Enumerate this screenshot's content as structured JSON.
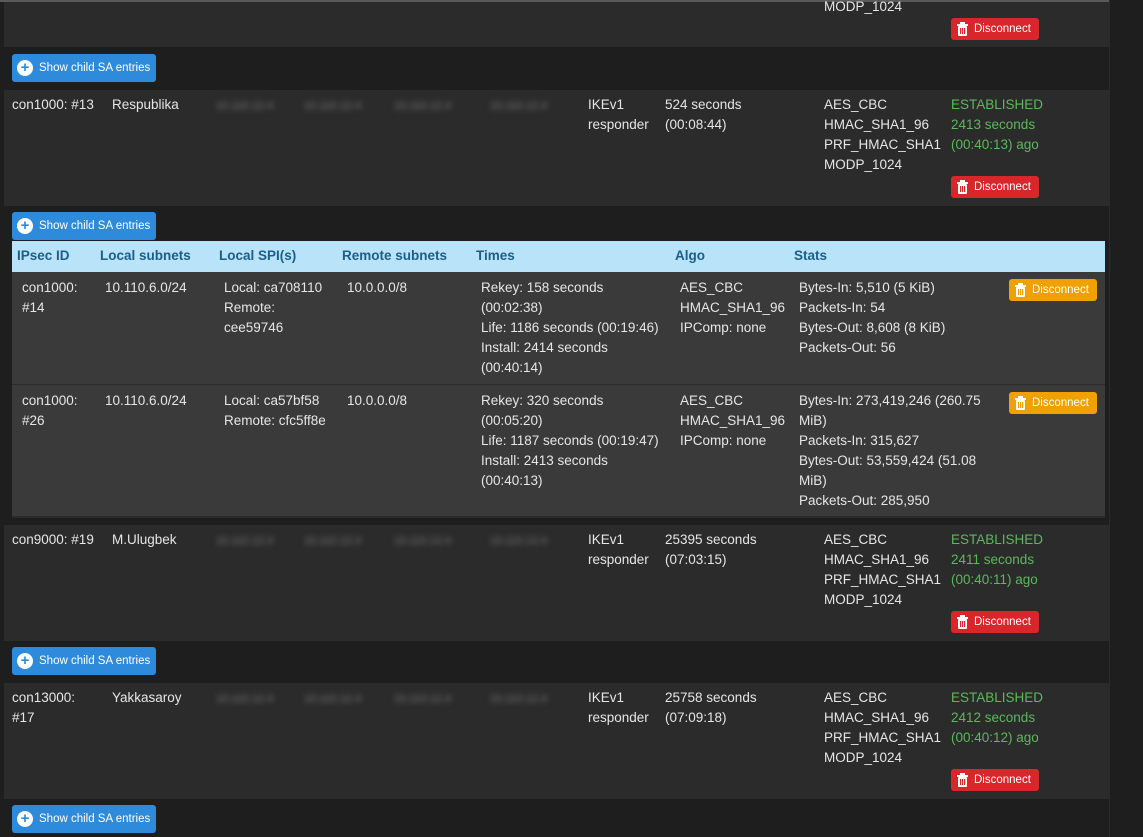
{
  "top_partial": {
    "algo_last": "MODP_1024",
    "disconnect_label": "Disconnect"
  },
  "show_child_label": "Show child SA entries",
  "blurred_address_placeholder": "10.110.12.4",
  "sa_entries": [
    {
      "id": "con1000: #13",
      "description": "Respublika",
      "ike_version": "IKEv1",
      "role": "responder",
      "life_seconds": "524 seconds",
      "life_hms": "(00:08:44)",
      "algo": [
        "AES_CBC",
        "HMAC_SHA1_96",
        "PRF_HMAC_SHA1",
        "MODP_1024"
      ],
      "status": "ESTABLISHED",
      "established_seconds": "2413 seconds",
      "established_ago": "(00:40:13) ago",
      "disconnect_label": "Disconnect"
    },
    {
      "id": "con9000: #19",
      "description": "M.Ulugbek",
      "ike_version": "IKEv1",
      "role": "responder",
      "life_seconds": "25395 seconds",
      "life_hms": "(07:03:15)",
      "algo": [
        "AES_CBC",
        "HMAC_SHA1_96",
        "PRF_HMAC_SHA1",
        "MODP_1024"
      ],
      "status": "ESTABLISHED",
      "established_seconds": "2411 seconds",
      "established_ago": "(00:40:11) ago",
      "disconnect_label": "Disconnect"
    },
    {
      "id_line1": "con13000:",
      "id_line2": "#17",
      "description": "Yakkasaroy",
      "ike_version": "IKEv1",
      "role": "responder",
      "life_seconds": "25758 seconds",
      "life_hms": "(07:09:18)",
      "algo": [
        "AES_CBC",
        "HMAC_SHA1_96",
        "PRF_HMAC_SHA1",
        "MODP_1024"
      ],
      "status": "ESTABLISHED",
      "established_seconds": "2412 seconds",
      "established_ago": "(00:40:12) ago",
      "disconnect_label": "Disconnect"
    }
  ],
  "child_table": {
    "headers": [
      "IPsec ID",
      "Local subnets",
      "Local SPI(s)",
      "Remote subnets",
      "Times",
      "Algo",
      "Stats"
    ],
    "rows": [
      {
        "ipsec_id": [
          "con1000:",
          "#14"
        ],
        "local_subnets": "10.110.6.0/24",
        "spis": [
          "Local: ca708110",
          "Remote:",
          "cee59746"
        ],
        "remote_subnets": "10.0.0.0/8",
        "times": [
          "Rekey: 158 seconds",
          "(00:02:38)",
          "Life: 1186 seconds (00:19:46)",
          "Install: 2414 seconds",
          "(00:40:14)"
        ],
        "algo": [
          "AES_CBC",
          "HMAC_SHA1_96",
          "IPComp: none"
        ],
        "stats": [
          "Bytes-In: 5,510 (5 KiB)",
          "Packets-In: 54",
          "Bytes-Out: 8,608 (8 KiB)",
          "Packets-Out: 56"
        ],
        "disconnect_label": "Disconnect"
      },
      {
        "ipsec_id": [
          "con1000:",
          "#26"
        ],
        "local_subnets": "10.110.6.0/24",
        "spis": [
          "Local: ca57bf58",
          "Remote: cfc5ff8e"
        ],
        "remote_subnets": "10.0.0.0/8",
        "times": [
          "Rekey: 320 seconds",
          "(00:05:20)",
          "Life: 1187 seconds (00:19:47)",
          "Install: 2413 seconds",
          "(00:40:13)"
        ],
        "algo": [
          "AES_CBC",
          "HMAC_SHA1_96",
          "IPComp: none"
        ],
        "stats": [
          "Bytes-In: 273,419,246 (260.75",
          "MiB)",
          "Packets-In: 315,627",
          "Bytes-Out: 53,559,424 (51.08",
          "MiB)",
          "Packets-Out: 285,950"
        ],
        "disconnect_label": "Disconnect"
      }
    ]
  },
  "colors": {
    "established": "#5cb85c",
    "disconnect_red": "#d9262a",
    "disconnect_orange": "#f0a000",
    "show_child_blue": "#2e8bdb",
    "child_header_bg": "#b8e3f8"
  }
}
